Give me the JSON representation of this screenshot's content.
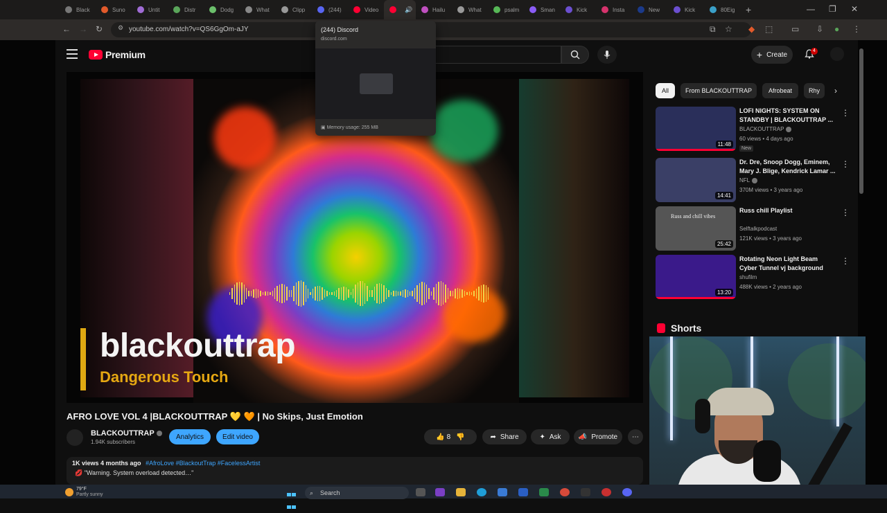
{
  "browser": {
    "tabs": [
      {
        "label": "Black",
        "fav": "#777777"
      },
      {
        "label": "Suno",
        "fav": "#e25a2b"
      },
      {
        "label": "Untit",
        "fav": "#a06cd5"
      },
      {
        "label": "Distr",
        "fav": "#5aa55a"
      },
      {
        "label": "Dodg",
        "fav": "#6bbf6b"
      },
      {
        "label": "What",
        "fav": "#888888"
      },
      {
        "label": "Clipp",
        "fav": "#999999"
      },
      {
        "label": "(244)",
        "fav": "#5865f2"
      },
      {
        "label": "Video",
        "fav": "#ff0033"
      },
      {
        "label": "",
        "fav": "#ff0033"
      },
      {
        "label": "Hailu",
        "fav": "#c050c0"
      },
      {
        "label": "What",
        "fav": "#999999"
      },
      {
        "label": "psalm",
        "fav": "#57b857"
      },
      {
        "label": "Sman",
        "fav": "#8a5cf6"
      },
      {
        "label": "Kick",
        "fav": "#6b4fd0"
      },
      {
        "label": "Insta",
        "fav": "#d6336c"
      },
      {
        "label": "New",
        "fav": "#1b3a8a"
      },
      {
        "label": "Kick",
        "fav": "#6b4fd0"
      },
      {
        "label": "80Eig",
        "fav": "#3aa0c8"
      }
    ],
    "url": "youtube.com/watch?v=QS6GgOm-aJY",
    "hover_card": {
      "title": "(244) Discord",
      "domain": "discord.com",
      "memory": "Memory usage: 255 MB"
    }
  },
  "youtube": {
    "logo_text": "Premium",
    "create_label": "Create",
    "notification_count": "4",
    "player": {
      "artist_text": "blackouttrap",
      "track_text": "Dangerous Touch"
    },
    "video": {
      "title": "AFRO LOVE VOL 4 |BLACKOUTTRAP 💛 🧡 | No Skips, Just Emotion",
      "channel": "BLACKOUTTRAP",
      "subscribers": "1.94K subscribers",
      "analytics_label": "Analytics",
      "edit_label": "Edit video",
      "likes": "8",
      "share_label": "Share",
      "ask_label": "Ask",
      "promote_label": "Promote",
      "views": "1K views",
      "age": "4 months ago",
      "tags": "#AfroLove #BlackoutTrap #FacelessArtist",
      "desc_line": "💋 \"Warning. System overload detected…\""
    },
    "chips": [
      "All",
      "From BLACKOUTTRAP",
      "Afrobeat",
      "Rhy"
    ],
    "recommendations": [
      {
        "title": "LOFI NIGHTS: SYSTEM ON STANDBY | BLACKOUTTRAP ...",
        "channel": "BLACKOUTTRAP",
        "meta": "60 views • 4 days ago",
        "duration": "11:48",
        "badge": "New",
        "thumb": "#2a2f5a"
      },
      {
        "title": "Dr. Dre, Snoop Dogg, Eminem, Mary J. Blige, Kendrick Lamar ...",
        "channel": "NFL",
        "meta": "370M views • 3 years ago",
        "duration": "14:41",
        "badge": "",
        "thumb": "#3a3f66"
      },
      {
        "title": "Russ chill Playlist",
        "channel": "Selftalkpodcast",
        "meta": "121K views • 3 years ago",
        "duration": "25:42",
        "badge": "",
        "thumb": "#555555",
        "overlay": "Russ and chill vibes"
      },
      {
        "title": "Rotating Neon Light Beam Cyber Tunnel vj background",
        "channel": "shufilm",
        "meta": "488K views • 2 years ago",
        "duration": "13:20",
        "badge": "",
        "thumb": "#3a1a8a"
      }
    ],
    "shorts_label": "Shorts"
  },
  "taskbar": {
    "weather_temp": "79°F",
    "weather_desc": "Partly sunny",
    "search_label": "Search"
  }
}
